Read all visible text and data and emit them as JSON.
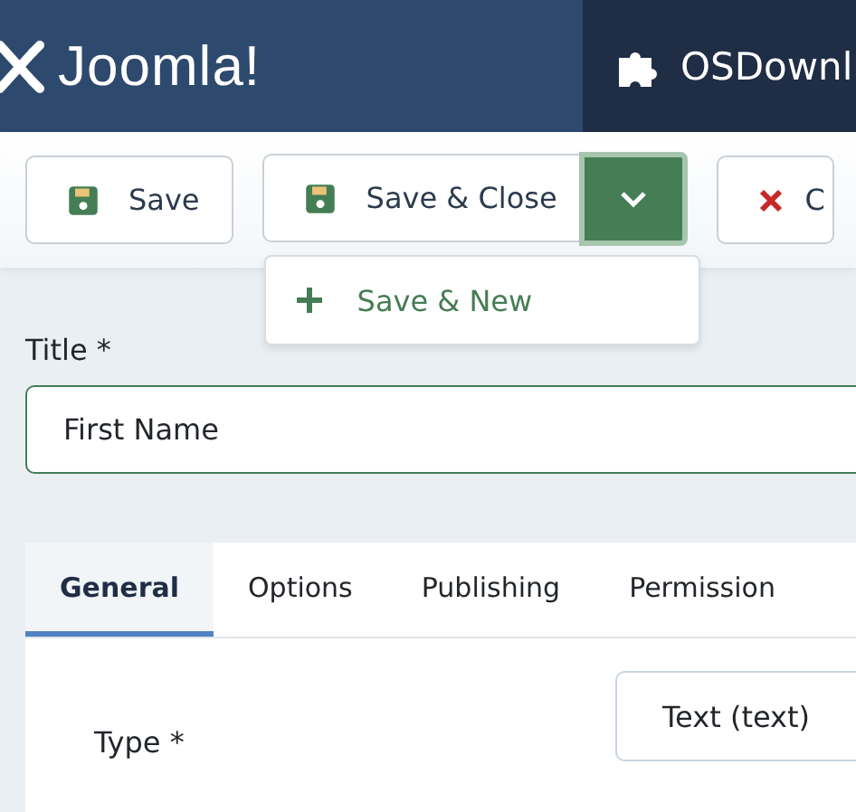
{
  "header": {
    "brand": "Joomla!",
    "component_title": "OSDownl"
  },
  "toolbar": {
    "buttons": [
      {
        "label": "Save",
        "kind": "save"
      },
      {
        "label": "Save & Close",
        "kind": "save"
      }
    ],
    "dropdown": {
      "expanded": true,
      "items": [
        {
          "label": "Save & New"
        }
      ]
    },
    "cancel": {
      "label": "C"
    }
  },
  "title_field": {
    "label": "Title *",
    "value": "First Name"
  },
  "tabs": [
    {
      "label": "General",
      "selected": true
    },
    {
      "label": "Options",
      "selected": false
    },
    {
      "label": "Publishing",
      "selected": false
    },
    {
      "label": "Permission",
      "selected": false
    }
  ],
  "general": {
    "type_label": "Type *",
    "type_value": "Text (text)"
  }
}
